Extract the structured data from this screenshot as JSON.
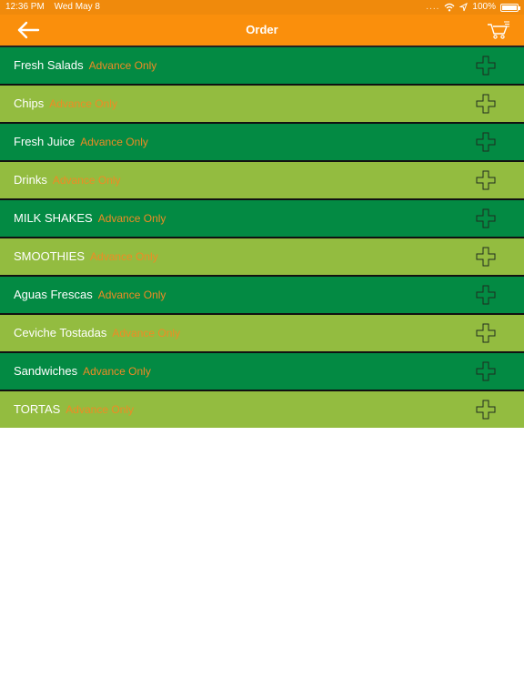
{
  "status_bar": {
    "time": "12:36 PM",
    "date": "Wed May 8",
    "battery": "100%"
  },
  "nav": {
    "title": "Order",
    "back_icon": "arrow-left-icon",
    "cart_icon": "cart-icon"
  },
  "colors": {
    "nav_bg": "#fa8f0c",
    "row_dark": "#038a43",
    "row_light": "#93bc40",
    "tag_color": "#f08a24"
  },
  "menu": {
    "items": [
      {
        "name": "Fresh Salads",
        "tag": "Advance Only"
      },
      {
        "name": "Chips",
        "tag": "Advance Only"
      },
      {
        "name": "Fresh Juice",
        "tag": "Advance Only"
      },
      {
        "name": "Drinks",
        "tag": "Advance Only"
      },
      {
        "name": "MILK SHAKES",
        "tag": "Advance Only"
      },
      {
        "name": "SMOOTHIES",
        "tag": "Advance Only"
      },
      {
        "name": "Aguas Frescas",
        "tag": "Advance Only"
      },
      {
        "name": "Ceviche Tostadas",
        "tag": "Advance Only"
      },
      {
        "name": "Sandwiches",
        "tag": "Advance Only"
      },
      {
        "name": "TORTAS",
        "tag": "Advance Only"
      }
    ]
  }
}
